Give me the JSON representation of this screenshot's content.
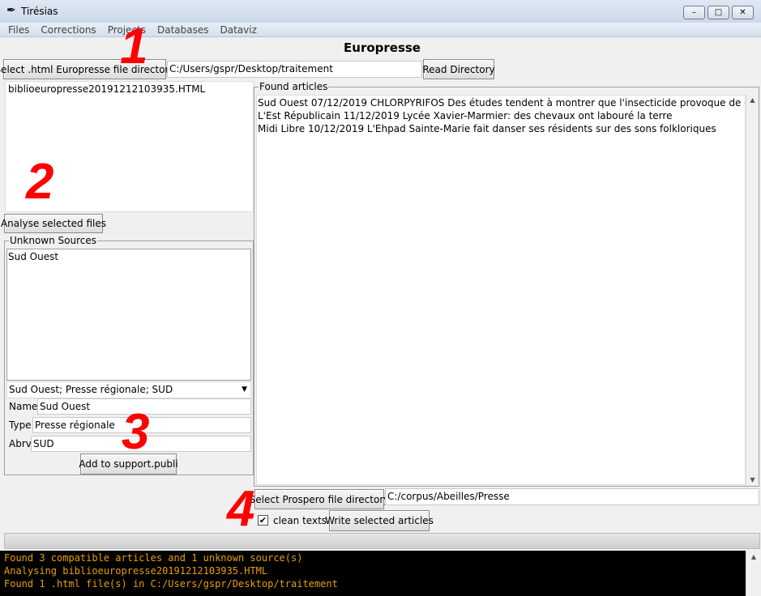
{
  "window": {
    "title": "Tirésias"
  },
  "menu": [
    "Files",
    "Corrections",
    "Projects",
    "Databases",
    "Dataviz"
  ],
  "heading": "Europresse",
  "europresse": {
    "select_button": "Select .html Europresse file directory",
    "path": "C:/Users/gspr/Desktop/traitement",
    "read_button": "Read Directory",
    "files": [
      "biblioeuropresse20191212103935.HTML"
    ],
    "analyse_button": "Analyse selected files"
  },
  "unknown_sources": {
    "label": "Unknown Sources",
    "items": [
      "Sud Ouest"
    ],
    "combo_value": "Sud Ouest; Presse régionale; SUD",
    "name_label": "Name",
    "name_value": "Sud Ouest",
    "type_label": "Type",
    "type_value": "Presse régionale",
    "abrv_label": "Abrv",
    "abrv_value": "SUD",
    "add_button": "Add to support.publi"
  },
  "found_articles": {
    "label": "Found articles",
    "items": [
      "Sud Ouest 07/12/2019 CHLORPYRIFOS Des études tendent à montrer que l'insecticide provoque de graves troubles",
      "L'Est Républicain 11/12/2019 Lycée Xavier-Marmier: des chevaux ont labouré la terre",
      "Midi Libre 10/12/2019 L'Ehpad Sainte-Marie fait danser ses résidents sur des sons folkloriques"
    ]
  },
  "prospero": {
    "select_button": "Select Prospero file directory",
    "path": "C:/corpus/Abeilles/Presse",
    "clean_texts_label": "clean texts",
    "clean_texts_checked": true,
    "write_button": "Write selected articles"
  },
  "progress": 0,
  "console": [
    "Found 3 compatible articles and 1 unknown source(s)",
    "Analysing biblioeuropresse20191212103935.HTML",
    "Found 1 .html file(s) in C:/Users/gspr/Desktop/traitement"
  ],
  "annotations": [
    "1",
    "2",
    "3",
    "4"
  ],
  "colors": {
    "annotation": "#ff0000",
    "console_text": "#e6a000",
    "console_bg": "#000000"
  }
}
